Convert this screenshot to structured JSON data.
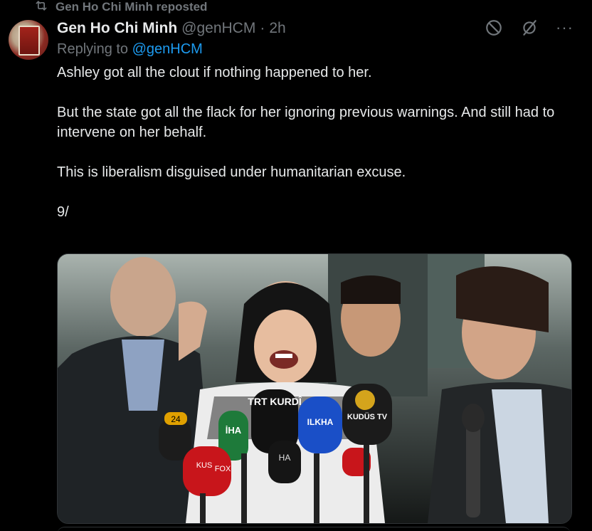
{
  "repost": {
    "icon": "repost-icon",
    "text": "Gen Ho Chi Minh reposted"
  },
  "author": {
    "display_name": "Gen Ho Chi Minh",
    "handle": "@genHCM",
    "separator": "·",
    "time": "2h"
  },
  "replying": {
    "prefix": "Replying to",
    "mention": "@genHCM"
  },
  "tweet": {
    "paragraphs": [
      "Ashley got all the clout if nothing happened to her.",
      "But the state got all the flack for her ignoring previous warnings. And still had to intervene on her behalf.",
      "This is liberalism disguised under humanitarian excuse.",
      "9/"
    ]
  },
  "media": {
    "mic_labels": [
      "TRT KURDÎ",
      "ILKHA",
      "KUDÜS TV",
      "24",
      "İHA",
      "KUS",
      "FOX",
      "HA"
    ]
  },
  "actions": {
    "block_icon": "block-icon",
    "grok_icon": "slash-circle-icon",
    "more_label": "···"
  },
  "colors": {
    "background": "#000000",
    "text": "#e7e9ea",
    "muted": "#71767b",
    "link": "#1d9bf0",
    "border": "#2f3336"
  }
}
